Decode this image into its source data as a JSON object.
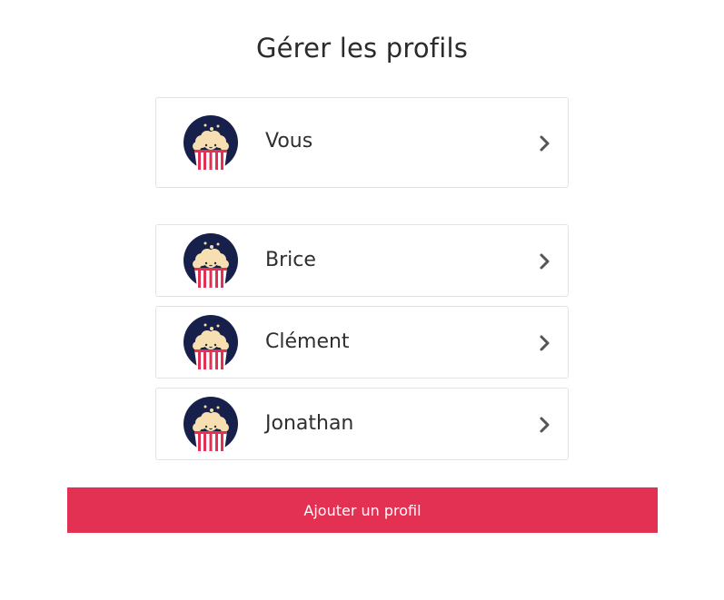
{
  "page": {
    "title": "Gérer les profils"
  },
  "profiles": {
    "me": {
      "name": "Vous"
    },
    "others": [
      {
        "name": "Brice"
      },
      {
        "name": "Clément"
      },
      {
        "name": "Jonathan"
      }
    ]
  },
  "actions": {
    "add_profile_label": "Ajouter un profil"
  },
  "icons": {
    "avatar": "popcorn-avatar-icon",
    "chevron": "chevron-right-icon"
  },
  "colors": {
    "accent": "#e33153",
    "avatar_bg": "#16204a",
    "popcorn": "#f7dfb2",
    "stripe_red": "#e33153"
  }
}
